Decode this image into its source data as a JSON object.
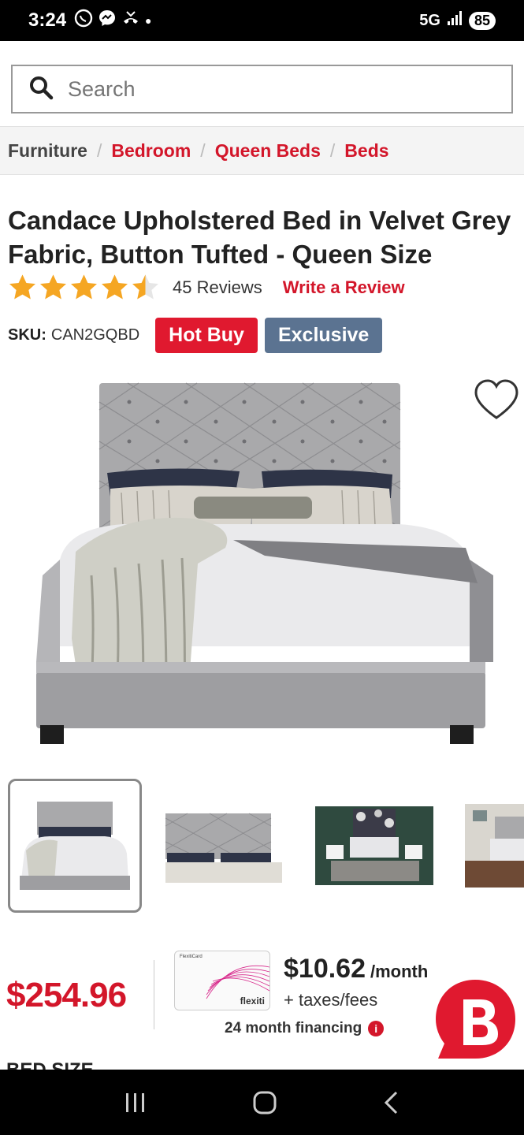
{
  "status_bar": {
    "time": "3:24",
    "network": "5G",
    "battery": "85"
  },
  "search": {
    "placeholder": "Search"
  },
  "breadcrumb": {
    "items": [
      "Furniture",
      "Bedroom",
      "Queen Beds",
      "Beds"
    ]
  },
  "product": {
    "title": "Candace Upholstered Bed in Velvet Grey Fabric, Button Tufted - Queen Size",
    "rating": 4.5,
    "rating_max": 5,
    "review_count": "45 Reviews",
    "write_review": "Write a Review",
    "sku_label": "SKU:",
    "sku_value": "CAN2GQBD",
    "badges": {
      "hot": "Hot Buy",
      "exclusive": "Exclusive"
    }
  },
  "pricing": {
    "price": "$254.96",
    "monthly_amount": "$10.62",
    "monthly_unit": "/month",
    "taxes": "+ taxes/fees",
    "financing": "24 month financing",
    "card_brand": "flexiti",
    "card_label": "FlexitiCard"
  },
  "options": {
    "bed_size_label": "BED SIZE"
  },
  "colors": {
    "accent_red": "#d3162a",
    "exclusive_blue": "#5b7391"
  }
}
